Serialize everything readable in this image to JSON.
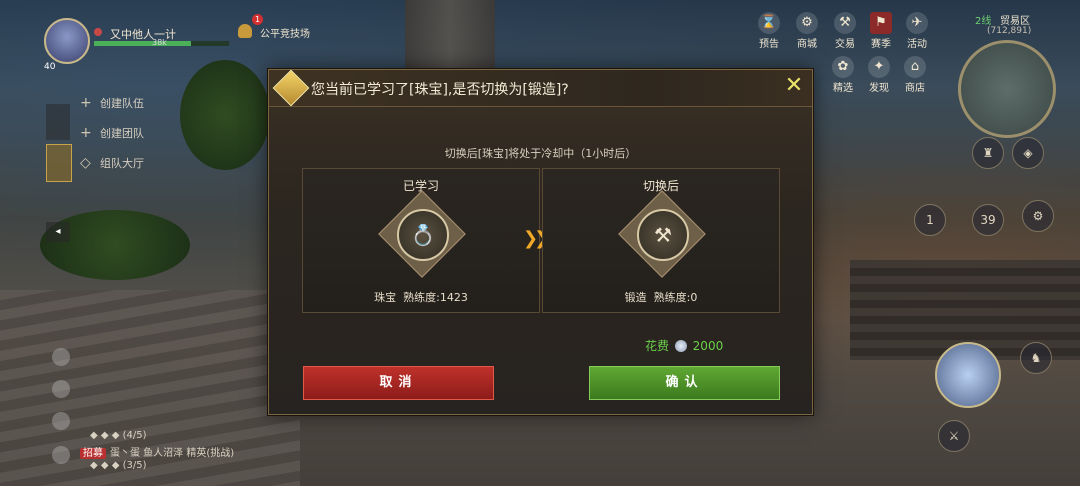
{
  "hud": {
    "player_name": "又中他人一计",
    "level": "40",
    "hp_text": "38k",
    "hp_fraction": 0.72,
    "arena_badge": "1",
    "arena_label": "公平竞技场"
  },
  "team_menu": {
    "create_party": "创建队伍",
    "create_group": "创建团队",
    "team_hall": "组队大厅"
  },
  "chat": {
    "line1": "(4/5)",
    "recruit_tag": "招募",
    "line2_text": "蛋丶蛋   鱼人沼泽   精英(挑战)",
    "line3": "(3/5)"
  },
  "top_icons": [
    {
      "label": "预告",
      "icon": "preview-icon"
    },
    {
      "label": "商城",
      "icon": "mall-icon"
    },
    {
      "label": "交易",
      "icon": "trade-icon"
    },
    {
      "label": "赛季",
      "icon": "season-icon"
    },
    {
      "label": "活动",
      "icon": "event-icon"
    },
    {
      "label": "精选",
      "icon": "featured-icon"
    },
    {
      "label": "发现",
      "icon": "discover-icon"
    },
    {
      "label": "商店",
      "icon": "shop-icon"
    }
  ],
  "map": {
    "line": "2线",
    "zone": "贸易区",
    "coords": "(712,891)"
  },
  "right_hud": {
    "counter_a": "1",
    "counter_b": "39"
  },
  "dialog": {
    "title": "您当前已学习了[珠宝],是否切换为[锻造]?",
    "subtitle": "切换后[珠宝]将处于冷却中（1小时后）",
    "learned": {
      "header": "已学习",
      "skill": "珠宝",
      "proficiency_label": "熟练度:",
      "proficiency": "1423"
    },
    "after": {
      "header": "切换后",
      "skill": "锻造",
      "proficiency_label": "熟练度:",
      "proficiency": "0"
    },
    "cost_label": "花费",
    "cost_value": "2000",
    "cancel_label": "取消",
    "confirm_label": "确认"
  },
  "colors": {
    "cancel": "#b02822",
    "confirm": "#4f9428",
    "cost_text": "#6cd04a",
    "accent_gold": "#e8c45a"
  }
}
